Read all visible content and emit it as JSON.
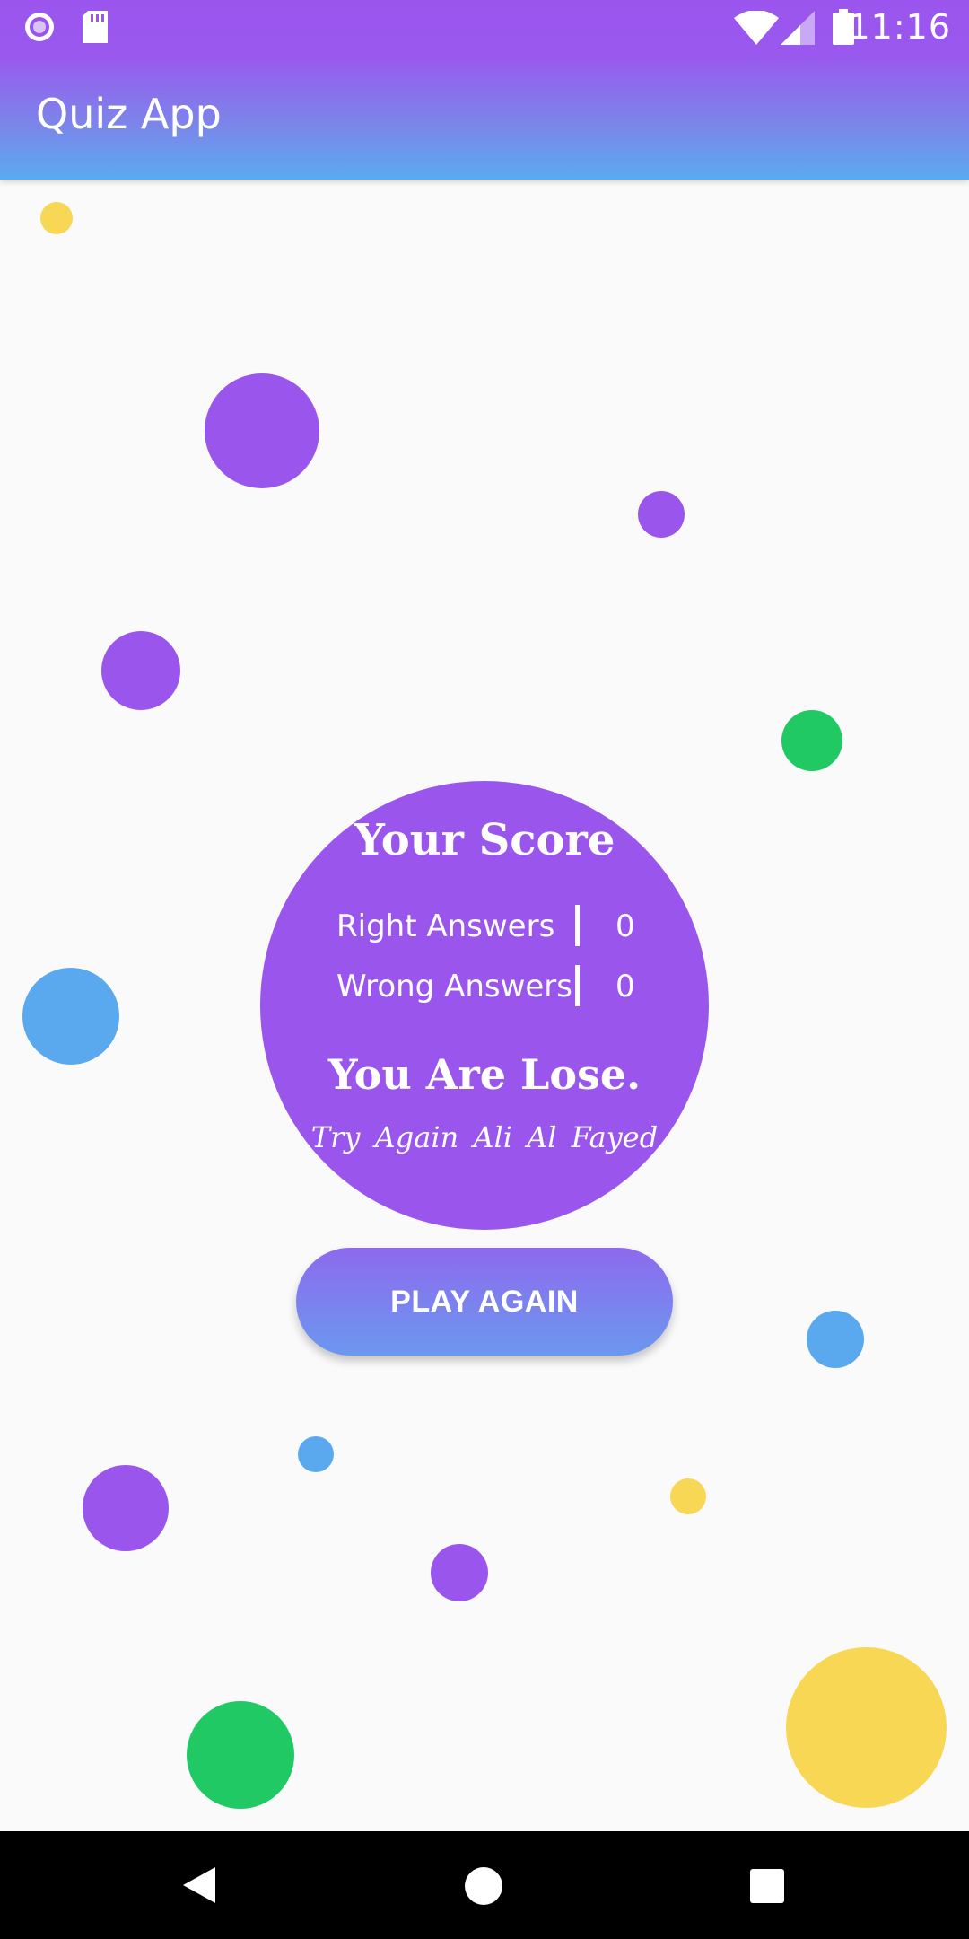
{
  "status_bar": {
    "time": "11:16",
    "left_icons": [
      "record-icon",
      "sd-card-icon"
    ],
    "right_icons": [
      "wifi-icon",
      "signal-icon",
      "battery-icon"
    ]
  },
  "app_bar": {
    "title": "Quiz App"
  },
  "score_card": {
    "title": "Your Score",
    "rows": [
      {
        "label": "Right Answers",
        "value": "0"
      },
      {
        "label": "Wrong Answers",
        "value": "0"
      }
    ],
    "result": "You Are Lose.",
    "signature": "Try Again  Ali Al Fayed"
  },
  "actions": {
    "play_again": "PLAY AGAIN"
  },
  "nav_bar": {
    "buttons": [
      "back-icon",
      "home-icon",
      "recents-icon"
    ]
  },
  "colors": {
    "purple": "#9a56ec",
    "blue": "#5aa9ee",
    "green": "#20c964",
    "yellow": "#f7d754",
    "background": "#fafafa"
  }
}
